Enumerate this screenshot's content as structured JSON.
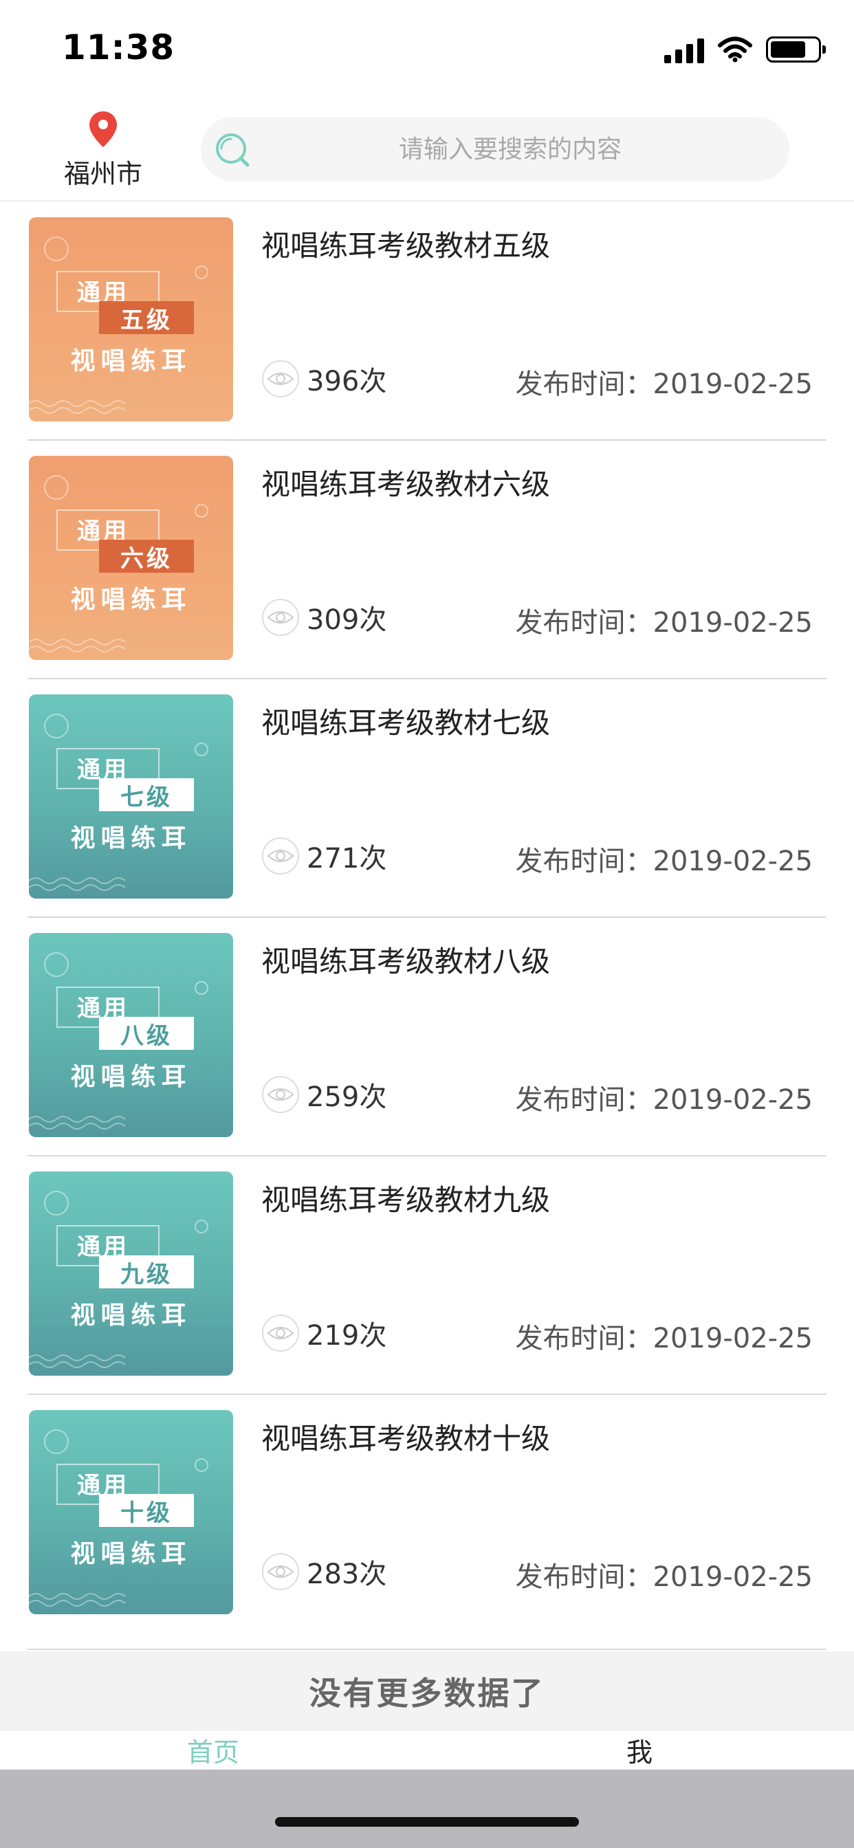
{
  "status_bar": {
    "time": "11:38"
  },
  "header": {
    "city": "福州市",
    "search_placeholder": "请输入要搜索的内容"
  },
  "items": [
    {
      "title": "视唱练耳考级教材五级",
      "views": "396次",
      "date_label": "发布时间：2019-02-25",
      "cover": {
        "theme": "orange",
        "tag": "通用",
        "level": "五级",
        "subtitle": "视唱练耳"
      }
    },
    {
      "title": "视唱练耳考级教材六级",
      "views": "309次",
      "date_label": "发布时间：2019-02-25",
      "cover": {
        "theme": "orange",
        "tag": "通用",
        "level": "六级",
        "subtitle": "视唱练耳"
      }
    },
    {
      "title": "视唱练耳考级教材七级",
      "views": "271次",
      "date_label": "发布时间：2019-02-25",
      "cover": {
        "theme": "teal",
        "tag": "通用",
        "level": "七级",
        "subtitle": "视唱练耳"
      }
    },
    {
      "title": "视唱练耳考级教材八级",
      "views": "259次",
      "date_label": "发布时间：2019-02-25",
      "cover": {
        "theme": "teal",
        "tag": "通用",
        "level": "八级",
        "subtitle": "视唱练耳"
      }
    },
    {
      "title": "视唱练耳考级教材九级",
      "views": "219次",
      "date_label": "发布时间：2019-02-25",
      "cover": {
        "theme": "teal",
        "tag": "通用",
        "level": "九级",
        "subtitle": "视唱练耳"
      }
    },
    {
      "title": "视唱练耳考级教材十级",
      "views": "283次",
      "date_label": "发布时间：2019-02-25",
      "cover": {
        "theme": "teal",
        "tag": "通用",
        "level": "十级",
        "subtitle": "视唱练耳"
      }
    }
  ],
  "footer": {
    "no_more_text": "没有更多数据了"
  },
  "tabbar": {
    "home_label": "首页",
    "me_label": "我"
  },
  "colors": {
    "accent": "#7cd0bf",
    "pin": "#e8453c",
    "orange_cover": "#f2a876",
    "teal_cover": "#5fb2ad"
  }
}
